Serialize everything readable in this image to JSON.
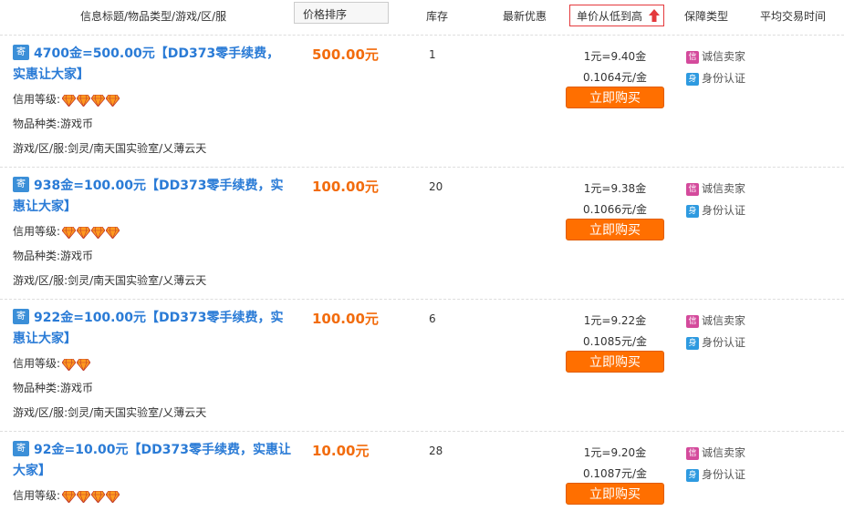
{
  "header": {
    "title_col": "信息标题/物品类型/游戏/区/服",
    "price_sort": "价格排序",
    "stock_col": "库存",
    "promo_col": "最新优惠",
    "unit_sort": "单价从低到高",
    "guarantee_col": "保障类型",
    "avg_time_col": "平均交易时间"
  },
  "labels": {
    "tag_icon": "寄",
    "credit": "信用等级:",
    "item_type": "物品种类:",
    "server": "游戏/区/服:",
    "buy": "立即购买",
    "honest_icon": "信",
    "honest": "诚信卖家",
    "id_icon": "身",
    "id": "身份认证"
  },
  "colors": {
    "title": "#2a7bd6",
    "price": "#f26c0d",
    "buy_button": "#ff6f00",
    "gem": "#ff9a1f"
  },
  "listings": [
    {
      "title": "4700金=500.00元【DD373零手续费，实惠让大家】",
      "credit_gems": 4,
      "item_type": "游戏币",
      "server": "剑灵/南天国实验室/乂薄云天",
      "price": "500.00元",
      "stock": "1",
      "rate": "1元=9.40金",
      "unit_price": "0.1064元/金"
    },
    {
      "title": "938金=100.00元【DD373零手续费，实惠让大家】",
      "credit_gems": 4,
      "item_type": "游戏币",
      "server": "剑灵/南天国实验室/乂薄云天",
      "price": "100.00元",
      "stock": "20",
      "rate": "1元=9.38金",
      "unit_price": "0.1066元/金"
    },
    {
      "title": "922金=100.00元【DD373零手续费，实惠让大家】",
      "credit_gems": 2,
      "item_type": "游戏币",
      "server": "剑灵/南天国实验室/乂薄云天",
      "price": "100.00元",
      "stock": "6",
      "rate": "1元=9.22金",
      "unit_price": "0.1085元/金"
    },
    {
      "title": "92金=10.00元【DD373零手续费，实惠让大家】",
      "credit_gems": 4,
      "item_type": "",
      "server": "",
      "price": "10.00元",
      "stock": "28",
      "rate": "1元=9.20金",
      "unit_price": "0.1087元/金"
    }
  ]
}
